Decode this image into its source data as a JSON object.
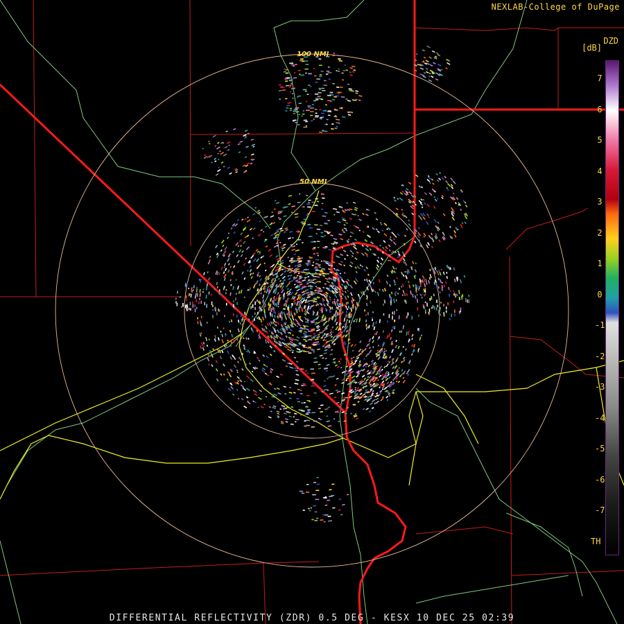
{
  "header": {
    "credit": "NEXLAB-College of DuPage"
  },
  "footer": {
    "product_title": "DIFFERENTIAL REFLECTIVITY (ZDR) 0.5 DEG - KESX 10 DEC 25 02:39"
  },
  "range_rings": {
    "inner_label": "50 NMI",
    "outer_label": "100 NMI"
  },
  "legend": {
    "title": "DZD",
    "unit": "[dB]",
    "ticks": [
      "7",
      "6",
      "5",
      "4",
      "3",
      "2",
      "1",
      "0",
      "-1",
      "-2",
      "-3",
      "-4",
      "-5",
      "-6",
      "-7",
      "TH"
    ]
  },
  "colors": {
    "state_border": "#ff1a1a",
    "county_line": "#c0201a",
    "highway": "#f0f020",
    "river": "#7ec87e",
    "range_ring": "#e8b896",
    "label": "#ffd84a"
  }
}
